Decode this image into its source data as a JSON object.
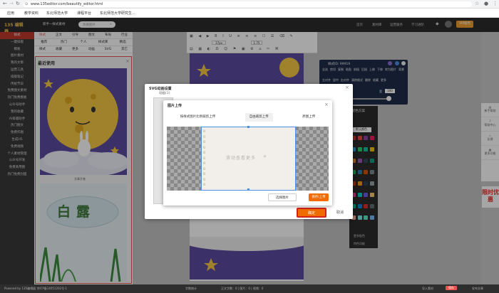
{
  "browser": {
    "url": "www.135editor.com/beautify_editor.html"
  },
  "bookmarks": [
    "应用",
    "教学资料",
    "东北师范大学",
    "课程平台",
    "东北师范大学研究生..."
  ],
  "header": {
    "logo": "编辑器",
    "center_link": "新手一样式素材",
    "search_placeholder": "热搜图片",
    "nav": [
      "首页",
      "素材库",
      "运营服务",
      "学习进阶"
    ],
    "vip_badge": "VIP服务",
    "panel_tabs": [
      "样式",
      "正文",
      "引导",
      "图文",
      "布局",
      "行业"
    ],
    "panel_subtabs": [
      "推荐",
      "热门",
      "个人",
      "样式库",
      "精选"
    ],
    "panel_subtabs2": [
      "样式",
      "收藏",
      "更多",
      "动画",
      "SVG",
      "其它"
    ]
  },
  "sidebar": {
    "items": [
      "样式",
      "一键排版",
      "模板",
      "图片素材",
      "我的文章",
      "运营工具",
      "排版笔记",
      "传统节日",
      "免费图文素材",
      "热门免费模板",
      "公众号助手",
      "我的收藏",
      "AI排版助手",
      "热门图文",
      "免费作图",
      "生成H5",
      "免费视频",
      "个人素材管理",
      "公众号开发",
      "免费商用图",
      "热门免费封面"
    ],
    "active_index": 0
  },
  "recent_panel": {
    "title": "最近使用",
    "card1_label": "文章开卷",
    "card2_title": "白露"
  },
  "toolbar": {
    "font_size": "17px",
    "line_spacing": "1.75",
    "buttons": [
      "复制",
      "保存",
      "清空",
      "预览"
    ]
  },
  "editor": {
    "card_label": "文章封面图"
  },
  "style_panel": {
    "id_label": "样式ID: 99919",
    "rows": [
      "全选",
      "剪切",
      "复制",
      "粘贴",
      "前插",
      "后插",
      "上移",
      "下移",
      "转为图片",
      "背景",
      "左对齐",
      "居中",
      "右对齐",
      "清除格式",
      "删除",
      "收藏",
      "更多"
    ],
    "bg_label": "背景色",
    "width_label": "宽",
    "width_value": "100",
    "color_codes": [
      "#F5A623",
      "#4A90E2"
    ]
  },
  "color_panel": {
    "title": "配色方案",
    "tab": "默认颜色",
    "more_label": "更多配色",
    "special_label": "特色功能",
    "swatches": [
      "#c0392b",
      "#e74c3c",
      "#8e44ad",
      "#e91e63",
      "#3498db",
      "#2ecc71",
      "#1abc9c",
      "#f1c40f",
      "#e67e22",
      "#9b59b6",
      "#34495e",
      "#16a085",
      "#27ae60",
      "#2980b9",
      "#d35400",
      "#7f8c8d",
      "#c0392b",
      "#f39c12",
      "#2c3e50",
      "#95a5a6",
      "#e84393",
      "#00cec9",
      "#6c5ce7",
      "#fdcb6e",
      "#00b894",
      "#0984e3",
      "#d63031",
      "#636e72",
      "#fab1a0",
      "#81ecec",
      "#55efc4",
      "#74b9ff"
    ]
  },
  "right_float": {
    "items": [
      "新手帮助",
      "帮助中心",
      "反馈",
      "更多功能"
    ],
    "promo": "限时优惠"
  },
  "svg_dialog": {
    "title": "SVG动画设置",
    "subtitle": "动画(1)",
    "confirm": "确定",
    "cancel": "取消"
  },
  "upload_dialog": {
    "title": "图片上传",
    "tabs": [
      "按样式图片比例裁剪上传",
      "自由裁剪上传",
      "原图上传"
    ],
    "active_tab": 1,
    "choose_button": "选择图片",
    "save_button": "保存/上传",
    "watermark": "滑动查看更多"
  },
  "status": {
    "left": "Powered by 135编辑器 京ICP备14051202号-1",
    "word_count": "字数统计",
    "center": "正文字数：0 | 图片：0 | 视频：0",
    "right_items": [
      "导入素材",
      "保存",
      "发布文章"
    ]
  }
}
